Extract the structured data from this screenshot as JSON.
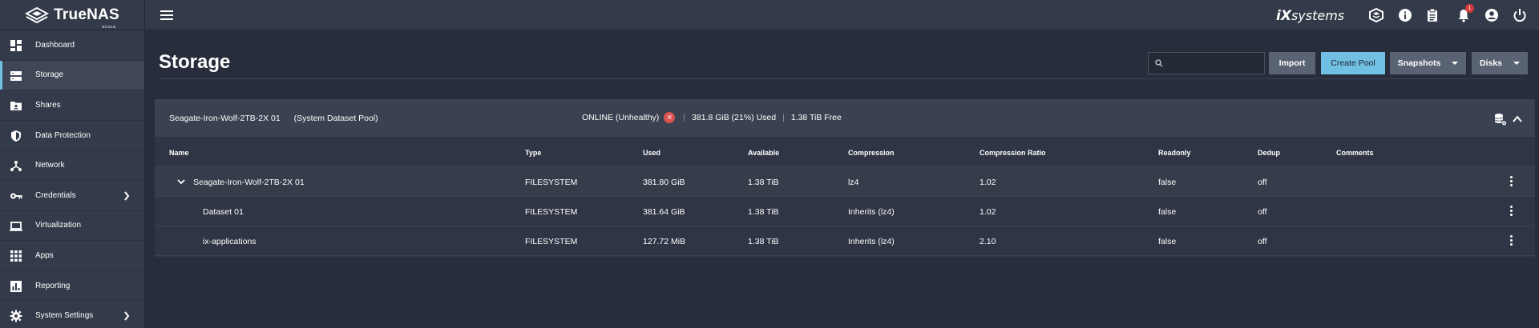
{
  "app": {
    "logo_text": "TrueNAS",
    "logo_sub": "SCALE",
    "brand_prefix": "iX",
    "brand_suffix": "systems"
  },
  "topbar_icons": [
    "truecommand-icon",
    "info-icon",
    "clipboard-icon",
    "bell-icon",
    "account-icon",
    "power-icon"
  ],
  "notifications": {
    "count": "1"
  },
  "sidebar": {
    "items": [
      {
        "label": "Dashboard",
        "icon": "dashboard-icon"
      },
      {
        "label": "Storage",
        "icon": "storage-icon"
      },
      {
        "label": "Shares",
        "icon": "shares-icon"
      },
      {
        "label": "Data Protection",
        "icon": "shield-icon"
      },
      {
        "label": "Network",
        "icon": "network-icon"
      },
      {
        "label": "Credentials",
        "icon": "key-icon"
      },
      {
        "label": "Virtualization",
        "icon": "laptop-icon"
      },
      {
        "label": "Apps",
        "icon": "apps-icon"
      },
      {
        "label": "Reporting",
        "icon": "chart-icon"
      },
      {
        "label": "System Settings",
        "icon": "gear-icon"
      }
    ]
  },
  "page": {
    "title": "Storage"
  },
  "toolbar": {
    "search_placeholder": "",
    "import_label": "Import",
    "create_pool_label": "Create Pool",
    "snapshots_label": "Snapshots",
    "disks_label": "Disks"
  },
  "pool": {
    "name": "Seagate-Iron-Wolf-2TB-2X 01",
    "system_label": "(System Dataset Pool)",
    "status": "ONLINE (Unhealthy)",
    "used": "381.8 GiB (21%) Used",
    "free": "1.38 TiB Free",
    "separator": "|"
  },
  "table": {
    "columns": [
      "Name",
      "Type",
      "Used",
      "Available",
      "Compression",
      "Compression Ratio",
      "Readonly",
      "Dedup",
      "Comments"
    ],
    "rows": [
      [
        "Seagate-Iron-Wolf-2TB-2X 01",
        "FILESYSTEM",
        "381.80 GiB",
        "1.38 TiB",
        "lz4",
        "1.02",
        "false",
        "off",
        ""
      ],
      [
        "Dataset 01",
        "FILESYSTEM",
        "381.64 GiB",
        "1.38 TiB",
        "Inherits (lz4)",
        "1.02",
        "false",
        "off",
        ""
      ],
      [
        "ix-applications",
        "FILESYSTEM",
        "127.72 MiB",
        "1.38 TiB",
        "Inherits (lz4)",
        "2.10",
        "false",
        "off",
        ""
      ]
    ]
  },
  "colors": {
    "accent": "#71bfe2",
    "error": "#d9534f",
    "background": "#272d3a",
    "panel": "#333a49"
  }
}
